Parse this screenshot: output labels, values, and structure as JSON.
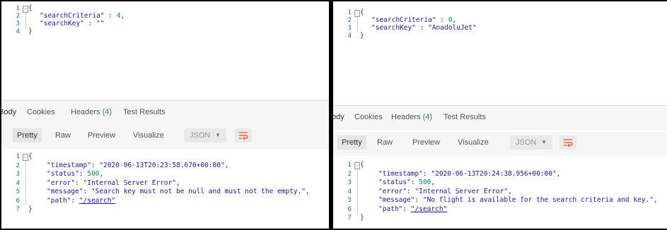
{
  "left": {
    "request_lines": [
      {
        "n": "1",
        "t": "{"
      },
      {
        "n": "2",
        "k": "\"searchCriteria\"",
        "sep": " : ",
        "v": "4",
        "vtype": "num",
        "end": ","
      },
      {
        "n": "3",
        "k": "\"searchKey\"",
        "sep": " : ",
        "v": "\"\"",
        "vtype": "str",
        "end": ""
      },
      {
        "n": "4",
        "t": "}"
      }
    ],
    "tabs": [
      {
        "label": "Body",
        "count": ""
      },
      {
        "label": "Cookies",
        "count": ""
      },
      {
        "label": "Headers",
        "count": "(4)"
      },
      {
        "label": "Test Results",
        "count": ""
      }
    ],
    "toolbar": {
      "pretty": "Pretty",
      "raw": "Raw",
      "preview": "Preview",
      "visualize": "Visualize",
      "format": "JSON"
    },
    "response_lines": [
      {
        "n": "1",
        "t": "{"
      },
      {
        "n": "2",
        "k": "\"timestamp\"",
        "sep": ": ",
        "v": "\"2020-06-13T20:23:58.670+00:00\"",
        "vtype": "str",
        "end": ","
      },
      {
        "n": "3",
        "k": "\"status\"",
        "sep": ": ",
        "v": "500",
        "vtype": "num",
        "end": ","
      },
      {
        "n": "4",
        "k": "\"error\"",
        "sep": ": ",
        "v": "\"Internal Server Error\"",
        "vtype": "str",
        "end": ","
      },
      {
        "n": "5",
        "k": "\"message\"",
        "sep": ": ",
        "v": "\"Search key must not be null and must not the empty.\"",
        "vtype": "str",
        "end": ","
      },
      {
        "n": "6",
        "k": "\"path\"",
        "sep": ": ",
        "v": "\"/search\"",
        "vtype": "link",
        "end": ""
      },
      {
        "n": "7",
        "t": "}"
      }
    ]
  },
  "right": {
    "request_lines": [
      {
        "n": "1",
        "t": "{"
      },
      {
        "n": "2",
        "k": "\"searchCriteria\"",
        "sep": " : ",
        "v": "0",
        "vtype": "num",
        "end": ","
      },
      {
        "n": "3",
        "k": "\"searchKey\"",
        "sep": " : ",
        "v": "\"AnadoluJet\"",
        "vtype": "str",
        "end": ""
      },
      {
        "n": "4",
        "t": "}"
      }
    ],
    "tabs": [
      {
        "label": "ody",
        "count": ""
      },
      {
        "label": "Cookies",
        "count": ""
      },
      {
        "label": "Headers",
        "count": "(4)"
      },
      {
        "label": "Test Results",
        "count": ""
      }
    ],
    "toolbar": {
      "pretty": "Pretty",
      "raw": "Raw",
      "preview": "Preview",
      "visualize": "Visualize",
      "format": "JSON"
    },
    "response_lines": [
      {
        "n": "1",
        "t": "{"
      },
      {
        "n": "2",
        "k": "\"timestamp\"",
        "sep": ": ",
        "v": "\"2020-06-13T20:24:38.956+00:00\"",
        "vtype": "str",
        "end": ","
      },
      {
        "n": "3",
        "k": "\"status\"",
        "sep": ": ",
        "v": "500",
        "vtype": "num",
        "end": ","
      },
      {
        "n": "4",
        "k": "\"error\"",
        "sep": ": ",
        "v": "\"Internal Server Error\"",
        "vtype": "str",
        "end": ","
      },
      {
        "n": "5",
        "k": "\"message\"",
        "sep": ": ",
        "v": "\"No flight is available for the search criteria and key.\"",
        "vtype": "str",
        "end": ","
      },
      {
        "n": "6",
        "k": "\"path\"",
        "sep": ": ",
        "v": "\"/search\"",
        "vtype": "link",
        "end": ""
      },
      {
        "n": "7",
        "t": "}"
      }
    ]
  },
  "colors": {
    "key": "#1a1aa6",
    "number": "#09885a",
    "line_number": "#2a5db0",
    "accent": "#f26b3a",
    "headers_count": "#2e8b57"
  },
  "icons": {
    "wrap": "wrap-lines-icon",
    "dropdown": "chevron-down-icon"
  }
}
